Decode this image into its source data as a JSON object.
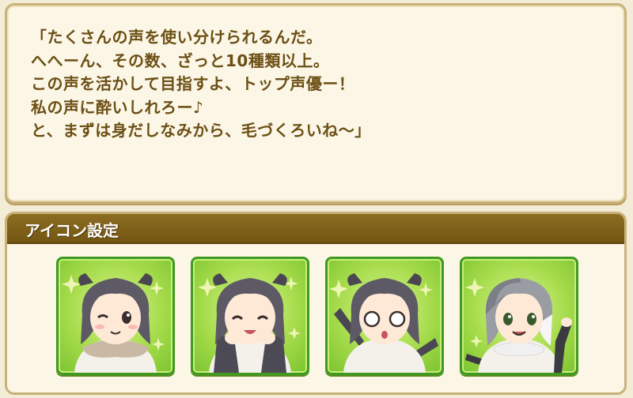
{
  "dialog": {
    "lines": [
      "「たくさんの声を使い分けられるんだ。",
      "へへーん、その数、ざっと10種類以上。",
      "この声を活かして目指すよ、トップ声優ー！",
      "私の声に酔いしれろー♪",
      "と、まずは身だしなみから、毛づくろいね～」"
    ]
  },
  "icon_settings": {
    "title": "アイコン設定",
    "icons": [
      {
        "expression": "wink"
      },
      {
        "expression": "smile-hands-cheeks"
      },
      {
        "expression": "surprised"
      },
      {
        "expression": "wave"
      }
    ]
  },
  "colors": {
    "text": "#6b4f14",
    "header_bg": "#7c5d17",
    "card_green": "#a7dc4c",
    "panel_bg": "#fbf6e6",
    "border_gold": "#c9b27a"
  }
}
